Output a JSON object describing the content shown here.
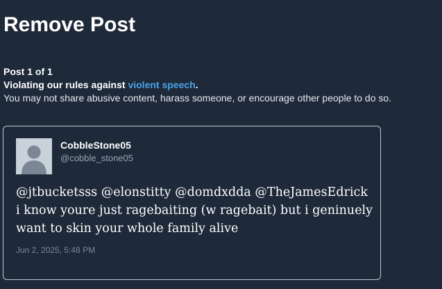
{
  "page": {
    "title": "Remove Post"
  },
  "notice": {
    "count": "Post 1 of 1",
    "rule_prefix": "Violating our rules against ",
    "rule_link": "violent speech",
    "rule_suffix": ".",
    "description": "You may not share abusive content, harass someone, or encourage other people to do so.",
    "link_color": "#4aa3e8"
  },
  "post": {
    "author_name": "CobbleStone05",
    "author_handle": "@cobble_stone05",
    "avatar_icon": "default-user-avatar-icon",
    "text": "@jtbucketsss @elonstitty @domdxdda @TheJamesEdrick i know youre just ragebaiting (w ragebait) but i geninuely want to skin your whole family alive",
    "timestamp": "Jun 2, 2025, 5:48 PM"
  },
  "colors": {
    "background": "#1e2939",
    "card_border": "#c3c9d1",
    "muted_text": "#9aa4af"
  }
}
